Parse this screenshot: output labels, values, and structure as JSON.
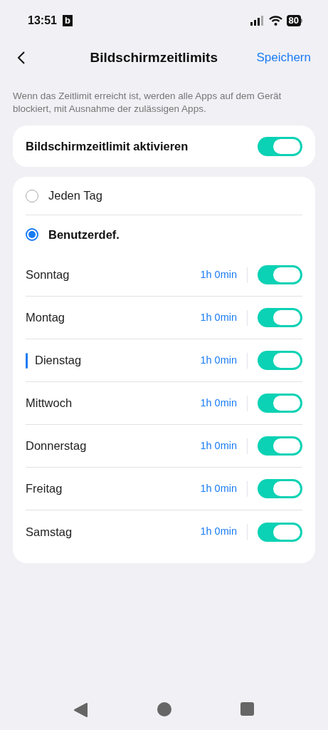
{
  "status_bar": {
    "time": "13:51",
    "app_badge": "b",
    "battery": "80"
  },
  "header": {
    "title": "Bildschirmzeitlimits",
    "action": "Speichern"
  },
  "description": "Wenn das Zeitlimit erreicht ist, werden alle Apps auf dem Gerät blockiert, mit Ausnahme der zulässigen Apps.",
  "master_toggle": {
    "label": "Bildschirmzeitlimit aktivieren",
    "on": true
  },
  "modes": [
    {
      "label": "Jeden Tag",
      "selected": false
    },
    {
      "label": "Benutzerdef.",
      "selected": true
    }
  ],
  "days": [
    {
      "label": "Sonntag",
      "limit": "1h 0min",
      "on": true,
      "focused": false
    },
    {
      "label": "Montag",
      "limit": "1h 0min",
      "on": true,
      "focused": false
    },
    {
      "label": "Dienstag",
      "limit": "1h 0min",
      "on": true,
      "focused": true
    },
    {
      "label": "Mittwoch",
      "limit": "1h 0min",
      "on": true,
      "focused": false
    },
    {
      "label": "Donnerstag",
      "limit": "1h 0min",
      "on": true,
      "focused": false
    },
    {
      "label": "Freitag",
      "limit": "1h 0min",
      "on": true,
      "focused": false
    },
    {
      "label": "Samstag",
      "limit": "1h 0min",
      "on": true,
      "focused": false
    }
  ]
}
